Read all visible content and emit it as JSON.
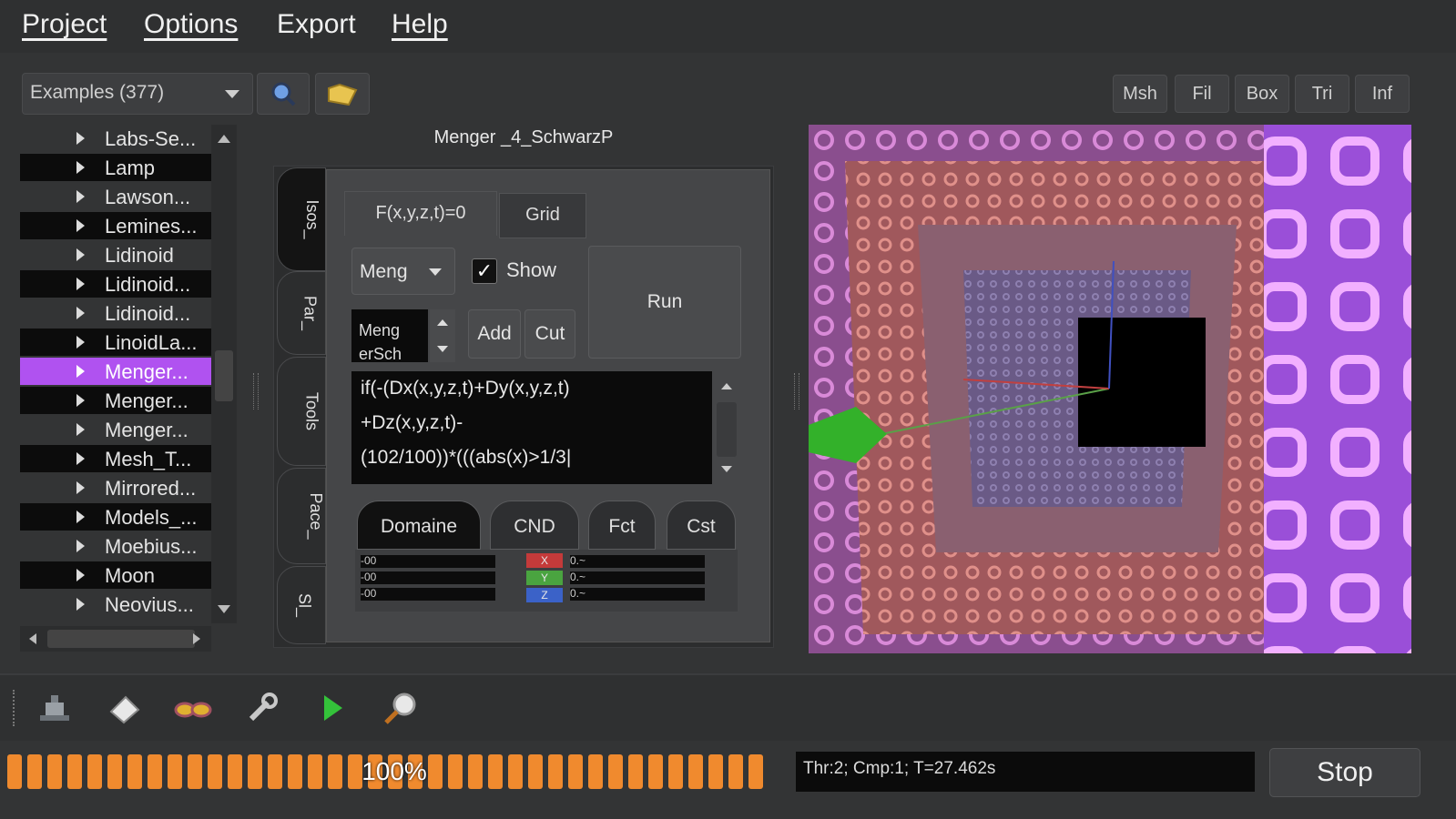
{
  "menu": {
    "items": [
      {
        "label": "Project"
      },
      {
        "label": "Options"
      },
      {
        "label": "Export"
      },
      {
        "label": "Help"
      }
    ]
  },
  "toolbar": {
    "examples_combo": "Examples (377)",
    "search_icon": "magnifier-icon",
    "open_icon": "folder-icon",
    "right_buttons": [
      "Msh",
      "Fil",
      "Box",
      "Tri",
      "Inf"
    ]
  },
  "tree": {
    "items": [
      "Labs-Se...",
      "Lamp",
      "Lawson...",
      "Lemines...",
      "Lidinoid",
      "Lidinoid...",
      "Lidinoid...",
      "LinoidLa...",
      "Menger...",
      "Menger...",
      "Menger...",
      "Mesh_T...",
      "Mirrored...",
      "Models_...",
      "Moebius...",
      "Moon",
      "Neovius..."
    ],
    "selected_index": 8
  },
  "panel": {
    "title": "Menger _4_SchwarzP",
    "side_tabs": [
      "Isos_",
      "Par_",
      "Tools",
      "Pace_",
      "Sl_"
    ],
    "tabs": [
      "F(x,y,z,t)=0",
      "Grid"
    ],
    "function_combo": "Meng",
    "show_label": "Show",
    "run_label": "Run",
    "spin_value": [
      "Meng",
      "erSch"
    ],
    "add_label": "Add",
    "cut_label": "Cut",
    "formula": [
      "if(-(Dx(x,y,z,t)+Dy(x,y,z,t)",
      "+Dz(x,y,z,t)-",
      "(102/100))*(((abs(x)>1/3|"
    ],
    "bottom_tabs": [
      "Domaine",
      "CND",
      "Fct",
      "Cst"
    ],
    "grid_left": [
      "-00",
      "-00",
      "-00"
    ],
    "grid_right": [
      "0.~",
      "0.~",
      "0.~"
    ],
    "axis_buttons": [
      "X",
      "Y",
      "Z"
    ]
  },
  "bottom_icons": [
    "robot-icon",
    "paper-icon",
    "glasses-icon",
    "wrench-icon",
    "play-icon",
    "zoom-icon"
  ],
  "status": {
    "progress_label": "100%",
    "progress_value": 1.0,
    "info": "Thr:2; Cmp:1; T=27.462s",
    "stop_label": "Stop"
  },
  "colors": {
    "accent": "#b052f0",
    "progress": "#f08a2e"
  }
}
